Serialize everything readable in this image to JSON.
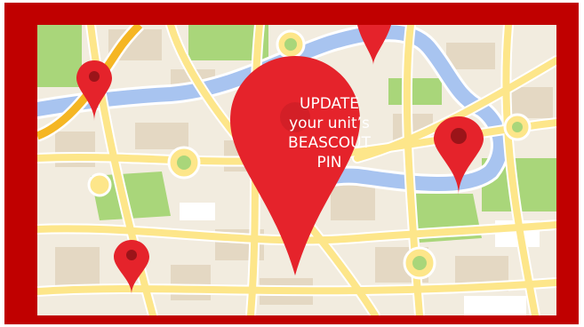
{
  "banner": {
    "line1": "UPDATE",
    "line2": "your unit’s",
    "line3": "BEASCOUT",
    "line4": "PIN"
  },
  "colors": {
    "frame": "#c00000",
    "map_background": "#f2ecdf",
    "road": "#fde68a",
    "road_outline": "#ffffff",
    "highway": "#f5b623",
    "river": "#a8c4f0",
    "park": "#a9d67a",
    "block": "#e4d8c3",
    "pin": "#e5232b",
    "pin_dot": "#9b1419",
    "text": "#ffffff"
  },
  "icons": {
    "map_pin": "map-pin-icon",
    "location_dot": "location-dot"
  }
}
